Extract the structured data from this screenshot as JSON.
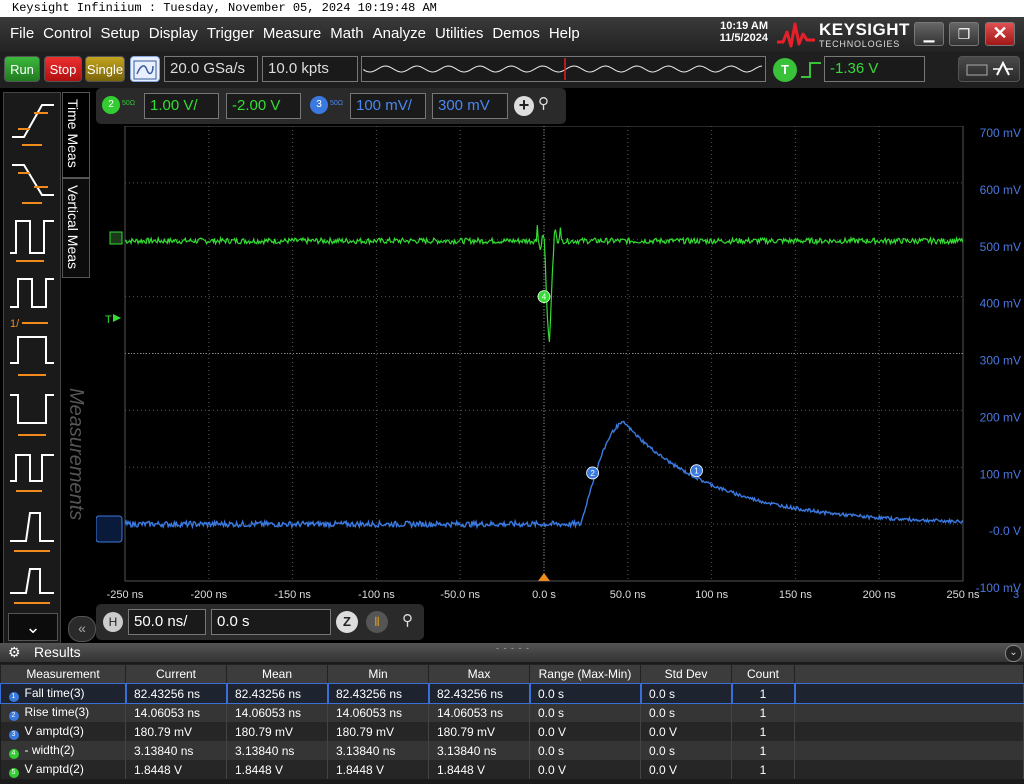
{
  "window": {
    "title": "Keysight Infiniium : Tuesday, November 05, 2024 10:19:48 AM"
  },
  "menu": [
    "File",
    "Control",
    "Setup",
    "Display",
    "Trigger",
    "Measure",
    "Math",
    "Analyze",
    "Utilities",
    "Demos",
    "Help"
  ],
  "clock": {
    "time": "10:19 AM",
    "date": "11/5/2024"
  },
  "logo": {
    "name": "KEYSIGHT",
    "sub": "TECHNOLOGIES"
  },
  "toolbar": {
    "run": "Run",
    "stop": "Stop",
    "single": "Single",
    "sample_rate": "20.0 GSa/s",
    "memory_depth": "10.0 kpts",
    "trigger_channel": "T",
    "trigger_level": "-1.36 V"
  },
  "side_tabs": {
    "time": "Time Meas",
    "vertical": "Vertical Meas",
    "measurements": "Measurements"
  },
  "channels": [
    {
      "number": "2",
      "impedance": "50Ω",
      "scale": "1.00 V/",
      "offset": "-2.00 V",
      "color": "#33dd33"
    },
    {
      "number": "3",
      "impedance": "50Ω",
      "scale": "100 mV/",
      "offset": "300 mV",
      "color": "#3a7ae0"
    }
  ],
  "timebase": {
    "label": "H",
    "scale": "50.0 ns/",
    "position": "0.0 s"
  },
  "axis": {
    "x_ticks": [
      "-250 ns",
      "-200 ns",
      "-150 ns",
      "-100 ns",
      "-50.0 ns",
      "0.0 s",
      "50.0 ns",
      "100 ns",
      "150 ns",
      "200 ns",
      "250 ns"
    ],
    "y_ticks": [
      "700 mV",
      "600 mV",
      "500 mV",
      "400 mV",
      "300 mV",
      "200 mV",
      "100 mV",
      "-0.0 V",
      "-100 mV"
    ],
    "corner_mark": "3",
    "trigger_marker": "T"
  },
  "waveform_markers": [
    {
      "label": "4",
      "color": "#33dd33"
    },
    {
      "label": "2",
      "color": "#3a7ae0"
    },
    {
      "label": "1",
      "color": "#3a7ae0"
    }
  ],
  "colors": {
    "ch2": "#33dd33",
    "ch3": "#3a7ae0",
    "y_axis_label": "#4a78e0",
    "grid": "#555555",
    "stop": "#e02020",
    "run": "#2a9a2a",
    "single": "#a08a10"
  },
  "results": {
    "title": "Results",
    "columns": [
      "Measurement",
      "Current",
      "Mean",
      "Min",
      "Max",
      "Range (Max-Min)",
      "Std Dev",
      "Count"
    ],
    "rows": [
      {
        "id": "1",
        "color": "#3a7ae0",
        "name": "Fall time(3)",
        "current": "82.43256 ns",
        "mean": "82.43256 ns",
        "min": "82.43256 ns",
        "max": "82.43256 ns",
        "range": "0.0 s",
        "std": "0.0 s",
        "count": "1"
      },
      {
        "id": "2",
        "color": "#3a7ae0",
        "name": "Rise time(3)",
        "current": "14.06053 ns",
        "mean": "14.06053 ns",
        "min": "14.06053 ns",
        "max": "14.06053 ns",
        "range": "0.0 s",
        "std": "0.0 s",
        "count": "1"
      },
      {
        "id": "3",
        "color": "#3a7ae0",
        "name": "V amptd(3)",
        "current": "180.79 mV",
        "mean": "180.79 mV",
        "min": "180.79 mV",
        "max": "180.79 mV",
        "range": "0.0 V",
        "std": "0.0 V",
        "count": "1"
      },
      {
        "id": "4",
        "color": "#33cc33",
        "name": "- width(2)",
        "current": "3.13840 ns",
        "mean": "3.13840 ns",
        "min": "3.13840 ns",
        "max": "3.13840 ns",
        "range": "0.0 s",
        "std": "0.0 s",
        "count": "1"
      },
      {
        "id": "5",
        "color": "#33cc33",
        "name": "V amptd(2)",
        "current": "1.8448 V",
        "mean": "1.8448 V",
        "min": "1.8448 V",
        "max": "1.8448 V",
        "range": "0.0 V",
        "std": "0.0 V",
        "count": "1"
      }
    ]
  }
}
